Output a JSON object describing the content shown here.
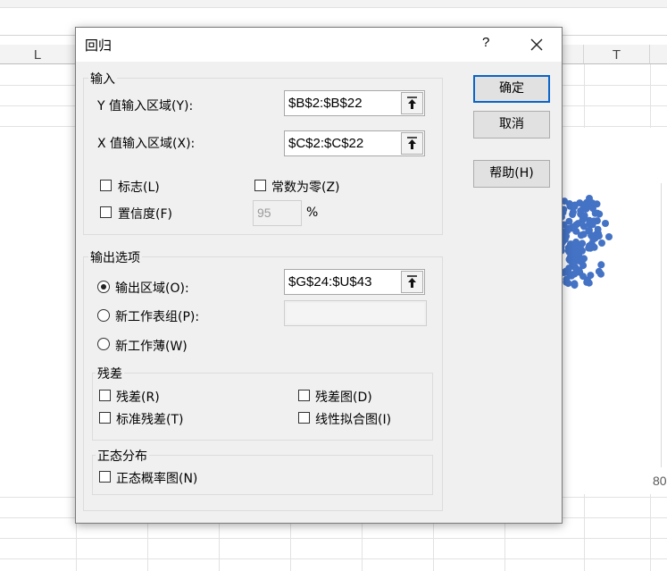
{
  "sheet": {
    "columns": [
      "L",
      "T"
    ],
    "axis_value": "80",
    "accent": "#4472c4"
  },
  "dialog": {
    "title": "回归",
    "help_glyph": "?",
    "close_icon": "close-icon",
    "input_group": {
      "title": "输入",
      "y_label": "Y 值输入区域(Y):",
      "y_range": "$B$2:$B$22",
      "x_label": "X 值输入区域(X):",
      "x_range": "$C$2:$C$22",
      "labels_checkbox": "标志(L)",
      "labels_checked": false,
      "constant_zero_checkbox": "常数为零(Z)",
      "constant_zero_checked": false,
      "confidence_checkbox": "置信度(F)",
      "confidence_checked": false,
      "confidence_value": "95",
      "percent": "%"
    },
    "output_group": {
      "title": "输出选项",
      "output_range_radio": "输出区域(O):",
      "output_range_selected": true,
      "output_range": "$G$24:$U$43",
      "new_sheet_radio": "新工作表组(P):",
      "new_sheet_value": "",
      "new_workbook_radio": "新工作薄(W)",
      "residuals": {
        "title": "残差",
        "residuals": "残差(R)",
        "residual_plots": "残差图(D)",
        "standardized_residuals": "标准残差(T)",
        "line_fit_plots": "线性拟合图(I)"
      },
      "normal": {
        "title": "正态分布",
        "normal_probability_plots": "正态概率图(N)"
      }
    },
    "buttons": {
      "ok": "确定",
      "cancel": "取消",
      "help": "帮助(H)"
    }
  }
}
